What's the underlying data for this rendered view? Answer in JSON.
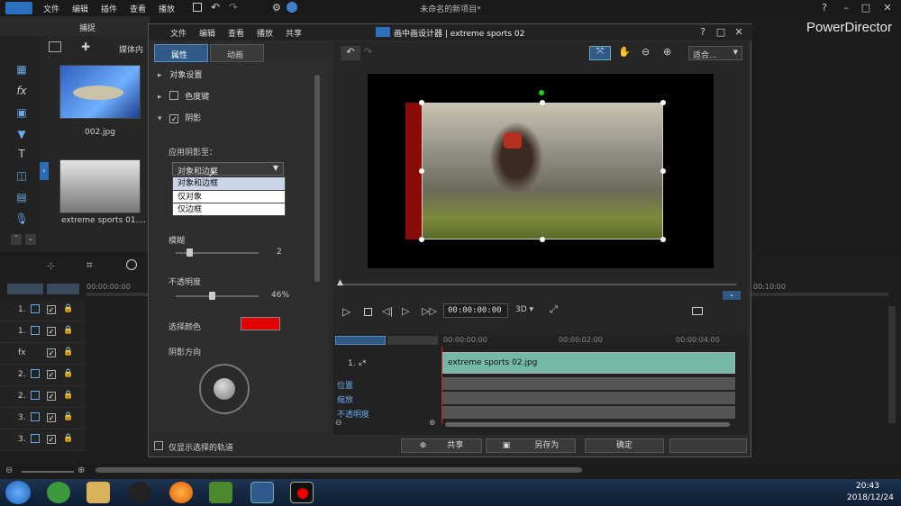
{
  "app": {
    "menu": [
      "文件",
      "编辑",
      "插件",
      "查看",
      "播放"
    ],
    "title": "未命名的新项目*",
    "brand": "PowerDirector"
  },
  "capture_label": "捕捉",
  "media": {
    "tab": "媒体内",
    "items": [
      {
        "label": "002.jpg"
      },
      {
        "label": "extreme sports 01...."
      }
    ]
  },
  "timeline": {
    "ruler": [
      "00:00:00:00",
      "00:10:00"
    ],
    "tracks": [
      "1.",
      "1.",
      "fx",
      "2.",
      "2.",
      "3.",
      "3."
    ]
  },
  "dialog": {
    "menu": [
      "文件",
      "编辑",
      "查看",
      "播放",
      "共享"
    ],
    "title": "画中画设计器 | extreme sports 02",
    "tabs": [
      "属性",
      "动画"
    ],
    "sections": [
      "对象设置",
      "色度键",
      "阴影"
    ],
    "apply_shadow_label": "应用阴影至：",
    "apply_shadow_value": "对象和边框",
    "dropdown_options": [
      "对象和边框",
      "仅对象",
      "仅边框"
    ],
    "blur_label": "模糊",
    "blur_value": "2",
    "opacity_label": "不透明度",
    "opacity_value": "46%",
    "color_label": "选择颜色",
    "shadow_color": "#e00000",
    "direction_label": "阴影方向",
    "only_selected_track": "仅显示选择的轨道",
    "zoom_label": "适合...",
    "timecode": "00:00:00:00",
    "mode_3d": "3D",
    "mini_timeline": {
      "ruler": [
        "00:00:00:00",
        "00:00:02:00",
        "00:00:04:00"
      ],
      "track_label": "1.",
      "clip": "extreme sports 02.jpg",
      "rows": [
        "位置",
        "缩放",
        "不透明度"
      ]
    },
    "buttons": {
      "share": "共享",
      "save_as": "另存为",
      "ok": "确定"
    }
  },
  "taskbar": {
    "time": "20:43",
    "date": "2018/12/24"
  }
}
